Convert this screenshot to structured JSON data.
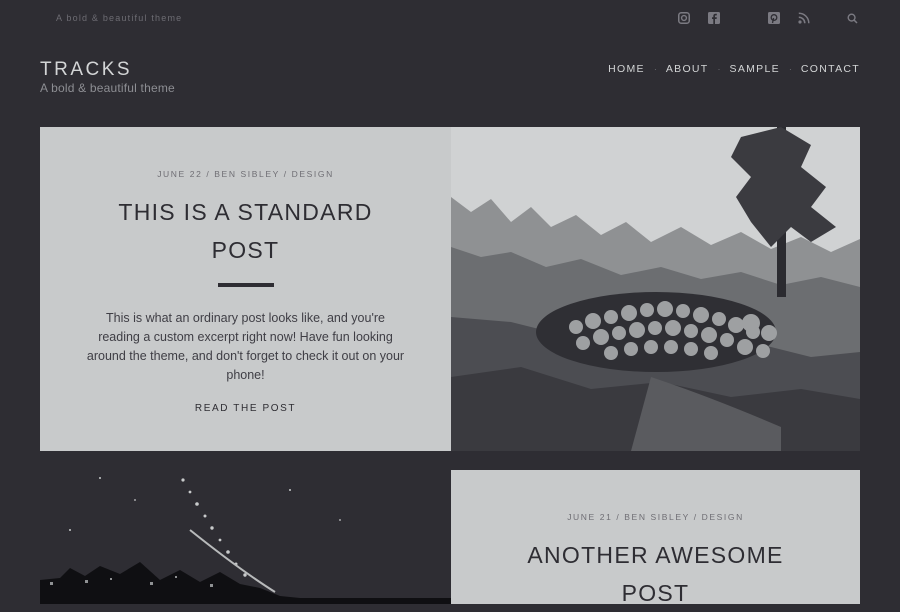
{
  "topbar": {
    "tagline": "A bold & beautiful theme",
    "icons": [
      "instagram-icon",
      "facebook-icon",
      "pinterest-icon",
      "rss-icon",
      "search-icon"
    ]
  },
  "header": {
    "site_title": "TRACKS",
    "site_description": "A bold & beautiful theme"
  },
  "nav": {
    "items": [
      {
        "label": "HOME"
      },
      {
        "label": "ABOUT"
      },
      {
        "label": "SAMPLE"
      },
      {
        "label": "CONTACT"
      }
    ],
    "separator": "·"
  },
  "posts": [
    {
      "meta": "JUNE 22 / BEN SIBLEY / DESIGN",
      "title": "THIS IS A STANDARD POST",
      "excerpt": "This is what an ordinary post looks like, and you're reading a custom excerpt right now! Have fun looking around the theme, and don't forget to check it out on your phone!",
      "read_more": "READ THE POST"
    },
    {
      "meta": "JUNE 21 / BEN SIBLEY / DESIGN",
      "title": "ANOTHER AWESOME POST"
    }
  ],
  "colors": {
    "background": "#2e2d33",
    "card": "#c8cacb",
    "text_dark": "#2e2d33",
    "text_light": "#d3d5d6"
  }
}
